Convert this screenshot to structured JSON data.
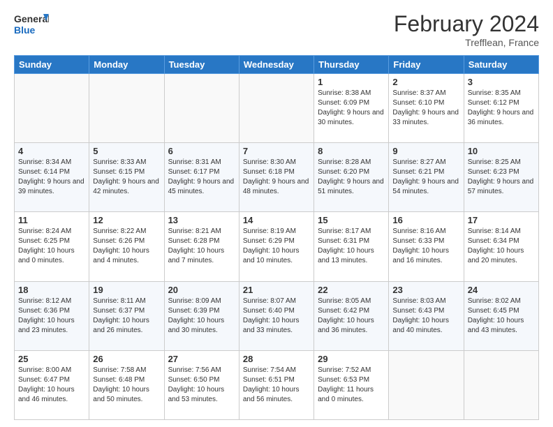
{
  "header": {
    "logo_general": "General",
    "logo_blue": "Blue",
    "month_year": "February 2024",
    "location": "Trefflean, France"
  },
  "days_of_week": [
    "Sunday",
    "Monday",
    "Tuesday",
    "Wednesday",
    "Thursday",
    "Friday",
    "Saturday"
  ],
  "weeks": [
    [
      {
        "day": "",
        "info": ""
      },
      {
        "day": "",
        "info": ""
      },
      {
        "day": "",
        "info": ""
      },
      {
        "day": "",
        "info": ""
      },
      {
        "day": "1",
        "info": "Sunrise: 8:38 AM\nSunset: 6:09 PM\nDaylight: 9 hours and 30 minutes."
      },
      {
        "day": "2",
        "info": "Sunrise: 8:37 AM\nSunset: 6:10 PM\nDaylight: 9 hours and 33 minutes."
      },
      {
        "day": "3",
        "info": "Sunrise: 8:35 AM\nSunset: 6:12 PM\nDaylight: 9 hours and 36 minutes."
      }
    ],
    [
      {
        "day": "4",
        "info": "Sunrise: 8:34 AM\nSunset: 6:14 PM\nDaylight: 9 hours and 39 minutes."
      },
      {
        "day": "5",
        "info": "Sunrise: 8:33 AM\nSunset: 6:15 PM\nDaylight: 9 hours and 42 minutes."
      },
      {
        "day": "6",
        "info": "Sunrise: 8:31 AM\nSunset: 6:17 PM\nDaylight: 9 hours and 45 minutes."
      },
      {
        "day": "7",
        "info": "Sunrise: 8:30 AM\nSunset: 6:18 PM\nDaylight: 9 hours and 48 minutes."
      },
      {
        "day": "8",
        "info": "Sunrise: 8:28 AM\nSunset: 6:20 PM\nDaylight: 9 hours and 51 minutes."
      },
      {
        "day": "9",
        "info": "Sunrise: 8:27 AM\nSunset: 6:21 PM\nDaylight: 9 hours and 54 minutes."
      },
      {
        "day": "10",
        "info": "Sunrise: 8:25 AM\nSunset: 6:23 PM\nDaylight: 9 hours and 57 minutes."
      }
    ],
    [
      {
        "day": "11",
        "info": "Sunrise: 8:24 AM\nSunset: 6:25 PM\nDaylight: 10 hours and 0 minutes."
      },
      {
        "day": "12",
        "info": "Sunrise: 8:22 AM\nSunset: 6:26 PM\nDaylight: 10 hours and 4 minutes."
      },
      {
        "day": "13",
        "info": "Sunrise: 8:21 AM\nSunset: 6:28 PM\nDaylight: 10 hours and 7 minutes."
      },
      {
        "day": "14",
        "info": "Sunrise: 8:19 AM\nSunset: 6:29 PM\nDaylight: 10 hours and 10 minutes."
      },
      {
        "day": "15",
        "info": "Sunrise: 8:17 AM\nSunset: 6:31 PM\nDaylight: 10 hours and 13 minutes."
      },
      {
        "day": "16",
        "info": "Sunrise: 8:16 AM\nSunset: 6:33 PM\nDaylight: 10 hours and 16 minutes."
      },
      {
        "day": "17",
        "info": "Sunrise: 8:14 AM\nSunset: 6:34 PM\nDaylight: 10 hours and 20 minutes."
      }
    ],
    [
      {
        "day": "18",
        "info": "Sunrise: 8:12 AM\nSunset: 6:36 PM\nDaylight: 10 hours and 23 minutes."
      },
      {
        "day": "19",
        "info": "Sunrise: 8:11 AM\nSunset: 6:37 PM\nDaylight: 10 hours and 26 minutes."
      },
      {
        "day": "20",
        "info": "Sunrise: 8:09 AM\nSunset: 6:39 PM\nDaylight: 10 hours and 30 minutes."
      },
      {
        "day": "21",
        "info": "Sunrise: 8:07 AM\nSunset: 6:40 PM\nDaylight: 10 hours and 33 minutes."
      },
      {
        "day": "22",
        "info": "Sunrise: 8:05 AM\nSunset: 6:42 PM\nDaylight: 10 hours and 36 minutes."
      },
      {
        "day": "23",
        "info": "Sunrise: 8:03 AM\nSunset: 6:43 PM\nDaylight: 10 hours and 40 minutes."
      },
      {
        "day": "24",
        "info": "Sunrise: 8:02 AM\nSunset: 6:45 PM\nDaylight: 10 hours and 43 minutes."
      }
    ],
    [
      {
        "day": "25",
        "info": "Sunrise: 8:00 AM\nSunset: 6:47 PM\nDaylight: 10 hours and 46 minutes."
      },
      {
        "day": "26",
        "info": "Sunrise: 7:58 AM\nSunset: 6:48 PM\nDaylight: 10 hours and 50 minutes."
      },
      {
        "day": "27",
        "info": "Sunrise: 7:56 AM\nSunset: 6:50 PM\nDaylight: 10 hours and 53 minutes."
      },
      {
        "day": "28",
        "info": "Sunrise: 7:54 AM\nSunset: 6:51 PM\nDaylight: 10 hours and 56 minutes."
      },
      {
        "day": "29",
        "info": "Sunrise: 7:52 AM\nSunset: 6:53 PM\nDaylight: 11 hours and 0 minutes."
      },
      {
        "day": "",
        "info": ""
      },
      {
        "day": "",
        "info": ""
      }
    ]
  ]
}
